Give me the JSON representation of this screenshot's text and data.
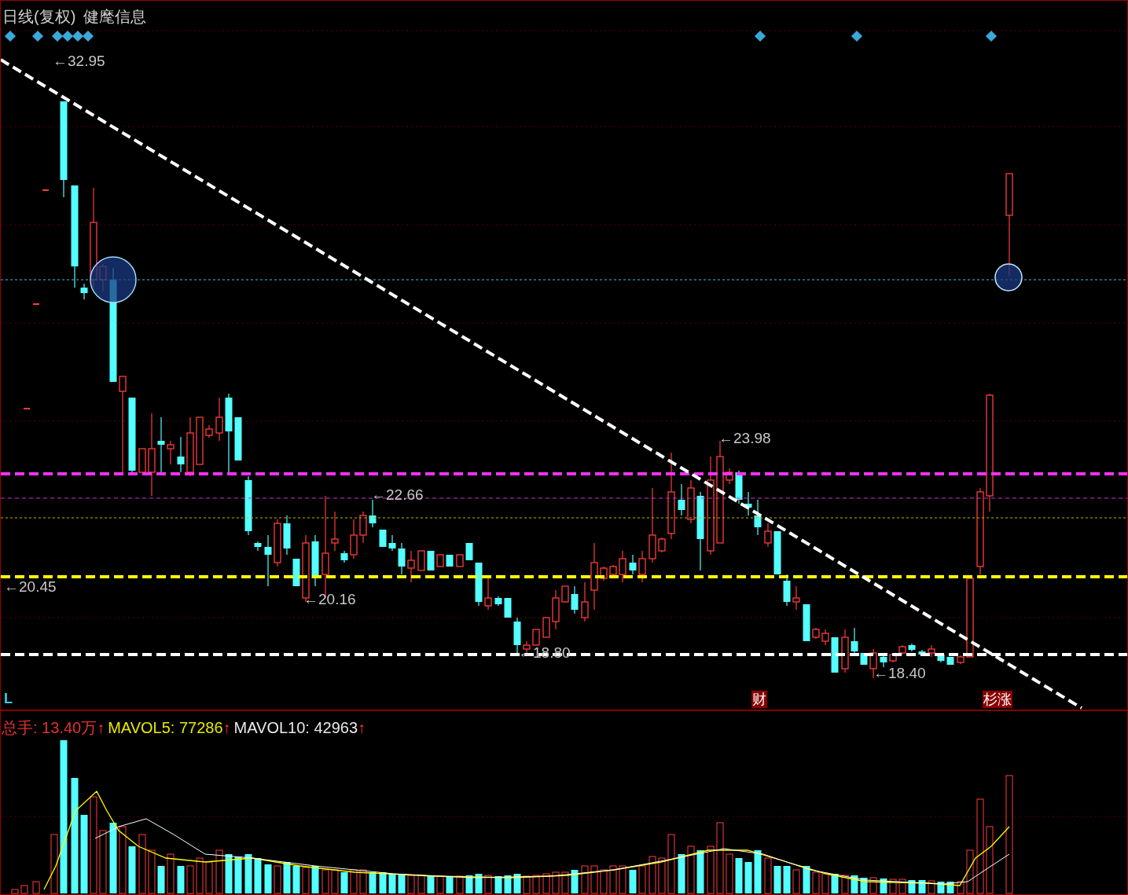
{
  "chart": {
    "period": "日线(复权)",
    "stock_name": "健麾信息"
  },
  "price_labels": [
    {
      "text": "←32.95"
    },
    {
      "text": "←23.98"
    },
    {
      "text": "←22.66"
    },
    {
      "text": "←20.45"
    },
    {
      "text": "←20.16"
    },
    {
      "text": "←18.80"
    },
    {
      "text": "←18.40"
    }
  ],
  "markers": [
    {
      "kind": "letter",
      "text": "L"
    },
    {
      "kind": "tag",
      "text": "财"
    },
    {
      "kind": "tag",
      "text": "杉涨"
    }
  ],
  "volume_legend": [
    {
      "label": "总手: 13.40万",
      "arrow": "↑",
      "color": "#e03030"
    },
    {
      "label": "MAVOL5: 77286",
      "arrow": "↑",
      "color": "#e8e800"
    },
    {
      "label": "MAVOL10: 42963",
      "arrow": "↑",
      "color": "#e8e8e8"
    }
  ]
}
